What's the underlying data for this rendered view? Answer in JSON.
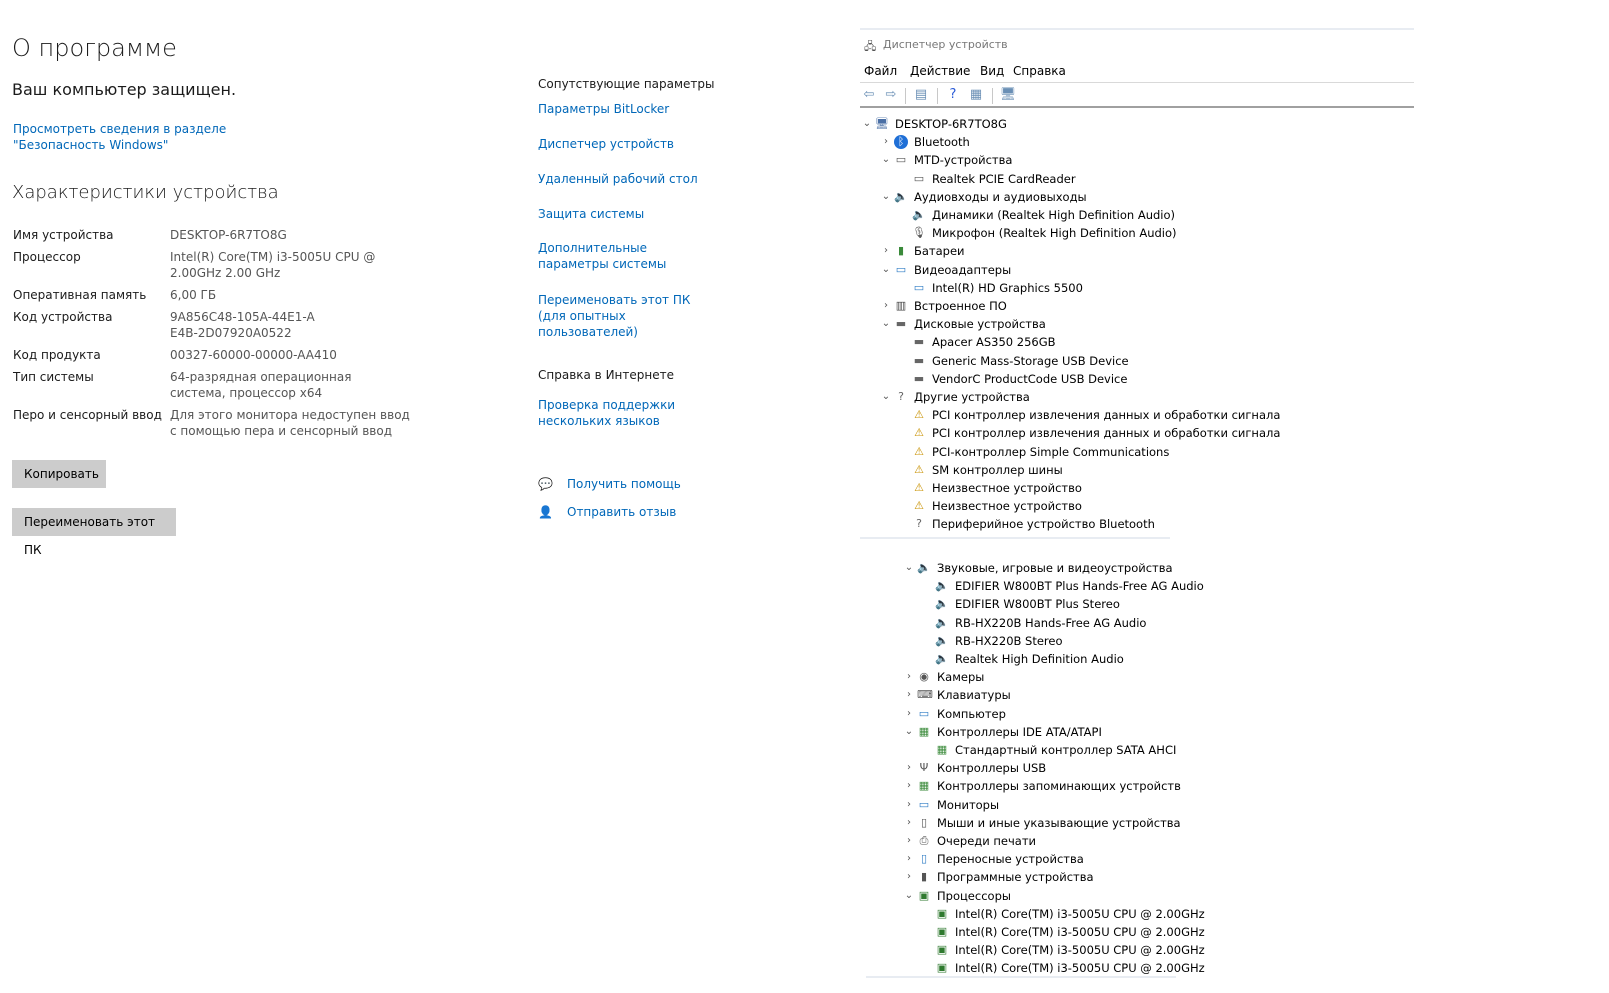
{
  "about": {
    "title": "О программе",
    "protection_status": "Ваш компьютер защищен.",
    "security_link": "Просмотреть сведения в разделе \"Безопасность Windows\"",
    "specs_title": "Характеристики устройства",
    "specs": [
      {
        "label": "Имя устройства",
        "value": "DESKTOP-6R7TO8G"
      },
      {
        "label": "Процессор",
        "value": "Intel(R) Core(TM) i3-5005U CPU @ 2.00GHz 2.00 GHz"
      },
      {
        "label": "Оперативная память",
        "value": "6,00 ГБ"
      },
      {
        "label": "Код устройства",
        "value": "9A856C48-105A-44E1-AE4B-2D07920A0522"
      },
      {
        "label": "Код продукта",
        "value": "00327-60000-00000-AA410"
      },
      {
        "label": "Тип системы",
        "value": "64-разрядная операционная система, процессор x64"
      },
      {
        "label": "Перо и сенсорный ввод",
        "value": "Для этого монитора недоступен ввод с помощью пера и сенсорный ввод"
      }
    ],
    "copy_button": "Копировать",
    "rename_button": "Переименовать этот ПК"
  },
  "related": {
    "heading": "Сопутствующие параметры",
    "links": [
      "Параметры BitLocker",
      "Диспетчер устройств",
      "Удаленный рабочий стол",
      "Защита системы",
      "Дополнительные параметры системы",
      "Переименовать этот ПК (для опытных пользователей)"
    ],
    "web_help_heading": "Справка в Интернете",
    "web_help_link": "Проверка поддержки нескольких языков",
    "get_help": "Получить помощь",
    "feedback": "Отправить отзыв"
  },
  "device_manager": {
    "title": "Диспетчер устройств",
    "menu": [
      "Файл",
      "Действие",
      "Вид",
      "Справка"
    ],
    "tree_top": [
      {
        "label": "DESKTOP-6R7TO8G",
        "level": 0,
        "expander": "open",
        "icon": "computer-icon"
      },
      {
        "label": "Bluetooth",
        "level": 1,
        "expander": "closed",
        "icon": "bluetooth-icon"
      },
      {
        "label": "MTD-устройства",
        "level": 1,
        "expander": "open",
        "icon": "storage-icon"
      },
      {
        "label": "Realtek PCIE CardReader",
        "level": 2,
        "expander": "none",
        "icon": "card-reader-icon"
      },
      {
        "label": "Аудиовходы и аудиовыходы",
        "level": 1,
        "expander": "open",
        "icon": "speaker-icon"
      },
      {
        "label": "Динамики (Realtek High Definition Audio)",
        "level": 2,
        "expander": "none",
        "icon": "speaker-icon"
      },
      {
        "label": "Микрофон (Realtek High Definition Audio)",
        "level": 2,
        "expander": "none",
        "icon": "microphone-icon"
      },
      {
        "label": "Батареи",
        "level": 1,
        "expander": "closed",
        "icon": "battery-icon"
      },
      {
        "label": "Видеоадаптеры",
        "level": 1,
        "expander": "open",
        "icon": "display-adapter-icon"
      },
      {
        "label": "Intel(R) HD Graphics 5500",
        "level": 2,
        "expander": "none",
        "icon": "display-adapter-icon"
      },
      {
        "label": "Встроенное ПО",
        "level": 1,
        "expander": "closed",
        "icon": "firmware-icon"
      },
      {
        "label": "Дисковые устройства",
        "level": 1,
        "expander": "open",
        "icon": "disk-icon"
      },
      {
        "label": "Apacer AS350 256GB",
        "level": 2,
        "expander": "none",
        "icon": "disk-icon"
      },
      {
        "label": "Generic Mass-Storage USB Device",
        "level": 2,
        "expander": "none",
        "icon": "disk-icon"
      },
      {
        "label": "VendorC ProductCode USB Device",
        "level": 2,
        "expander": "none",
        "icon": "disk-icon"
      },
      {
        "label": "Другие устройства",
        "level": 1,
        "expander": "open",
        "icon": "unknown-device-icon"
      },
      {
        "label": "PCI контроллер извлечения данных и обработки сигнала",
        "level": 2,
        "expander": "none",
        "icon": "warning-icon"
      },
      {
        "label": "PCI контроллер извлечения данных и обработки сигнала",
        "level": 2,
        "expander": "none",
        "icon": "warning-icon"
      },
      {
        "label": "PCI-контроллер Simple Communications",
        "level": 2,
        "expander": "none",
        "icon": "warning-icon"
      },
      {
        "label": "SM контроллер шины",
        "level": 2,
        "expander": "none",
        "icon": "warning-icon"
      },
      {
        "label": "Неизвестное устройство",
        "level": 2,
        "expander": "none",
        "icon": "warning-icon"
      },
      {
        "label": "Неизвестное устройство",
        "level": 2,
        "expander": "none",
        "icon": "warning-icon"
      },
      {
        "label": "Периферийное устройство Bluetooth",
        "level": 2,
        "expander": "none",
        "icon": "unknown-device-icon"
      }
    ],
    "tree_bottom": [
      {
        "label": "Звуковые, игровые и видеоустройства",
        "level": 1,
        "expander": "open",
        "icon": "speaker-icon"
      },
      {
        "label": "EDIFIER W800BT Plus Hands-Free AG Audio",
        "level": 2,
        "expander": "none",
        "icon": "speaker-icon"
      },
      {
        "label": "EDIFIER W800BT Plus Stereo",
        "level": 2,
        "expander": "none",
        "icon": "speaker-icon"
      },
      {
        "label": "RB-HX220B Hands-Free AG Audio",
        "level": 2,
        "expander": "none",
        "icon": "speaker-icon"
      },
      {
        "label": "RB-HX220B Stereo",
        "level": 2,
        "expander": "none",
        "icon": "speaker-icon"
      },
      {
        "label": "Realtek High Definition Audio",
        "level": 2,
        "expander": "none",
        "icon": "speaker-icon"
      },
      {
        "label": "Камеры",
        "level": 1,
        "expander": "closed",
        "icon": "camera-icon"
      },
      {
        "label": "Клавиатуры",
        "level": 1,
        "expander": "closed",
        "icon": "keyboard-icon"
      },
      {
        "label": "Компьютер",
        "level": 1,
        "expander": "closed",
        "icon": "monitor-icon"
      },
      {
        "label": "Контроллеры IDE ATA/ATAPI",
        "level": 1,
        "expander": "open",
        "icon": "ide-controller-icon"
      },
      {
        "label": "Стандартный контроллер SATA AHCI",
        "level": 2,
        "expander": "none",
        "icon": "ide-controller-icon"
      },
      {
        "label": "Контроллеры USB",
        "level": 1,
        "expander": "closed",
        "icon": "usb-icon"
      },
      {
        "label": "Контроллеры запоминающих устройств",
        "level": 1,
        "expander": "closed",
        "icon": "storage-controller-icon"
      },
      {
        "label": "Мониторы",
        "level": 1,
        "expander": "closed",
        "icon": "monitor-icon"
      },
      {
        "label": "Мыши и иные указывающие устройства",
        "level": 1,
        "expander": "closed",
        "icon": "mouse-icon"
      },
      {
        "label": "Очереди печати",
        "level": 1,
        "expander": "closed",
        "icon": "printer-icon"
      },
      {
        "label": "Переносные устройства",
        "level": 1,
        "expander": "closed",
        "icon": "portable-device-icon"
      },
      {
        "label": "Программные устройства",
        "level": 1,
        "expander": "closed",
        "icon": "software-device-icon"
      },
      {
        "label": "Процессоры",
        "level": 1,
        "expander": "open",
        "icon": "processor-icon"
      },
      {
        "label": "Intel(R) Core(TM) i3-5005U CPU @ 2.00GHz",
        "level": 2,
        "expander": "none",
        "icon": "processor-icon"
      },
      {
        "label": "Intel(R) Core(TM) i3-5005U CPU @ 2.00GHz",
        "level": 2,
        "expander": "none",
        "icon": "processor-icon"
      },
      {
        "label": "Intel(R) Core(TM) i3-5005U CPU @ 2.00GHz",
        "level": 2,
        "expander": "none",
        "icon": "processor-icon"
      },
      {
        "label": "Intel(R) Core(TM) i3-5005U CPU @ 2.00GHz",
        "level": 2,
        "expander": "none",
        "icon": "processor-icon"
      }
    ]
  }
}
